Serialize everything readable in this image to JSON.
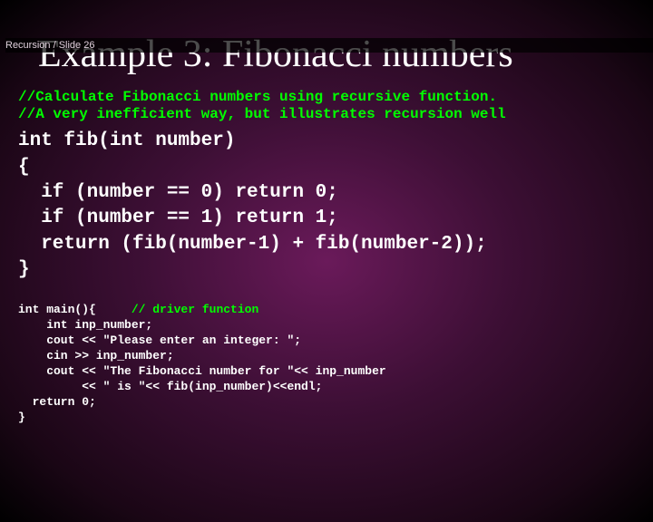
{
  "breadcrumb": "Recursion / Slide 26",
  "title": "Example 3: Fibonacci numbers",
  "comment1": "//Calculate Fibonacci numbers using recursive function.",
  "comment2": "//A very inefficient way, but illustrates recursion well",
  "code": "int fib(int number)\n{\n  if (number == 0) return 0;\n  if (number == 1) return 1;\n  return (fib(number-1) + fib(number-2));\n}",
  "driver_prefix": "int main(){     ",
  "driver_comment": "// driver function",
  "driver_body": "    int inp_number;\n    cout << \"Please enter an integer: \";\n    cin >> inp_number;\n    cout << \"The Fibonacci number for \"<< inp_number\n         << \" is \"<< fib(inp_number)<<endl;\n  return 0;\n}"
}
